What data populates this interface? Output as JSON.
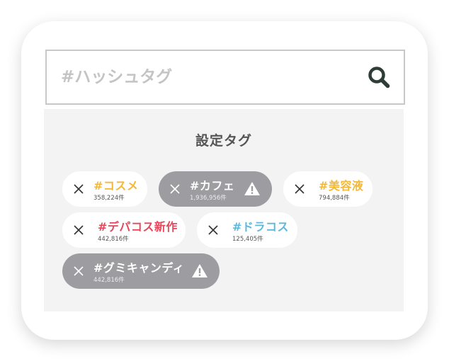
{
  "search": {
    "placeholder": "#ハッシュタグ",
    "value": ""
  },
  "panel": {
    "title": "設定タグ"
  },
  "tags": [
    {
      "name": "#コスメ",
      "count": "358,224件",
      "color": "#f3b83a",
      "flagged": false
    },
    {
      "name": "#カフェ",
      "count": "1,936,956件",
      "color": "#ffffff",
      "flagged": true
    },
    {
      "name": "#美容液",
      "count": "794,884件",
      "color": "#f3b83a",
      "flagged": false
    },
    {
      "name": "#デパコス新作",
      "count": "442,816件",
      "color": "#e8465a",
      "flagged": false
    },
    {
      "name": "#ドラコス",
      "count": "125,405件",
      "color": "#5cb8dc",
      "flagged": false
    },
    {
      "name": "#グミキャンディ",
      "count": "442,816件",
      "color": "#ffffff",
      "flagged": true
    }
  ],
  "colors": {
    "flagged_bg": "#9d9ca1",
    "panel_bg": "#f3f3f3",
    "search_icon": "#2f3d37"
  },
  "icons": {
    "search": "search-icon",
    "remove": "close-icon",
    "warning": "warning-icon"
  }
}
